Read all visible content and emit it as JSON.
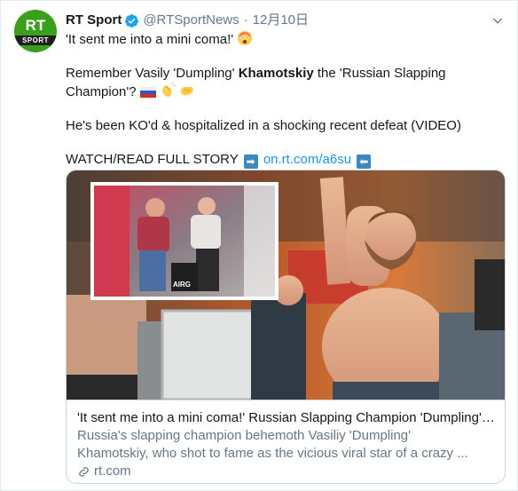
{
  "author": {
    "name": "RT Sport",
    "handle": "@RTSportNews",
    "separator": "·",
    "time": "12月10日",
    "avatar_text_top": "RT",
    "avatar_text_bottom": "SPORT"
  },
  "tweet": {
    "line1": "'It sent me into a mini coma!'",
    "line2_before": "Remember Vasily 'Dumpling' ",
    "line2_bold": "Khamotskiy",
    "line2_after": " the 'Russian Slapping Champion'?",
    "line3": "He's been KO'd & hospitalized in a shocking recent defeat (VIDEO)",
    "line4_label": "WATCH/READ FULL STORY",
    "line4_link": "on.rt.com/a6su"
  },
  "card": {
    "title": "'It sent me into a mini coma!' Russian Slapping Champion 'Dumpling' ...",
    "desc_line1": "Russia's slapping champion behemoth Vasiliy 'Dumpling'",
    "desc_line2": "Khamotskiy, who shot to fame as the vicious viral star of a crazy ...",
    "domain": "rt.com",
    "inset_banner": "AIRG"
  },
  "colors": {
    "brand": "#3aa01b",
    "link": "#1b95e0",
    "verified": "#1da1f2",
    "muted": "#657786"
  },
  "icons": [
    "verified-badge-icon",
    "caret-down-icon",
    "astonished-face-icon",
    "russia-flag-icon",
    "clapping-hands-icon",
    "right-arrow-icon",
    "left-arrow-icon",
    "link-icon"
  ]
}
